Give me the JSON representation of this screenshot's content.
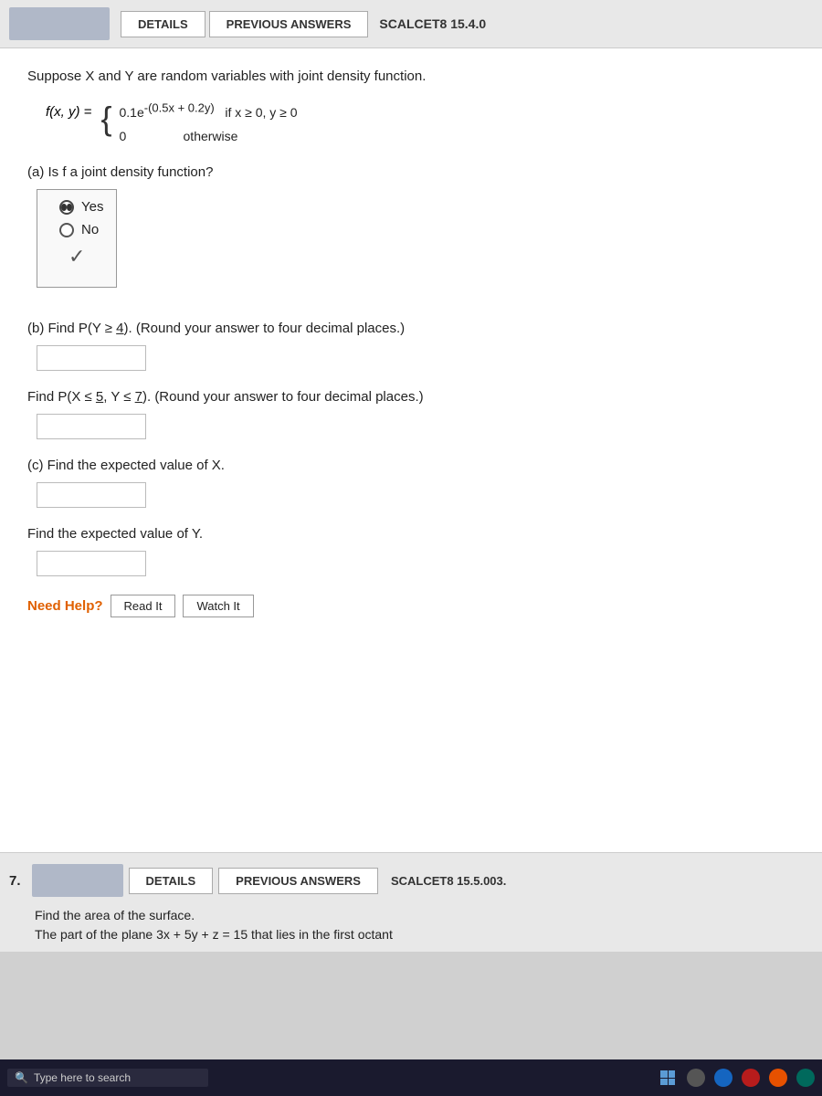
{
  "header": {
    "details_label": "DETAILS",
    "previous_answers_label": "PREVIOUS ANSWERS",
    "scalcet_label": "SCALCET8 15.4.0"
  },
  "problem": {
    "intro": "Suppose X and Y are random variables with joint density function.",
    "formula": {
      "label": "f(x, y) =",
      "case1_expr": "0.1e",
      "case1_exp": "-(0.5x + 0.2y)",
      "case1_condition": "if x ≥ 0, y ≥ 0",
      "case2_expr": "0",
      "case2_condition": "otherwise"
    },
    "part_a": {
      "question": "(a) Is f a joint density function?",
      "yes_label": "Yes",
      "no_label": "No",
      "selected": "yes"
    },
    "part_b": {
      "question1": "(b) Find P(Y ≥ 4). (Round your answer to four decimal places.)",
      "question2": "Find P(X ≤ 5, Y ≤ 7). (Round your answer to four decimal places.)",
      "answer1": "",
      "answer2": ""
    },
    "part_c": {
      "question1": "(c) Find the expected value of X.",
      "question2": "Find the expected value of Y.",
      "answer1": "",
      "answer2": ""
    },
    "need_help": {
      "label": "Need Help?",
      "read_it": "Read It",
      "watch_it": "Watch It"
    }
  },
  "problem7": {
    "number": "7.",
    "details_label": "DETAILS",
    "previous_answers_label": "PREVIOUS ANSWERS",
    "scalcet_label": "SCALCET8 15.5.003.",
    "text1": "Find the area of the surface.",
    "text2": "The part of the plane  3x + 5y + z = 15  that lies in the first octant"
  },
  "taskbar": {
    "search_placeholder": "Type here to search"
  }
}
